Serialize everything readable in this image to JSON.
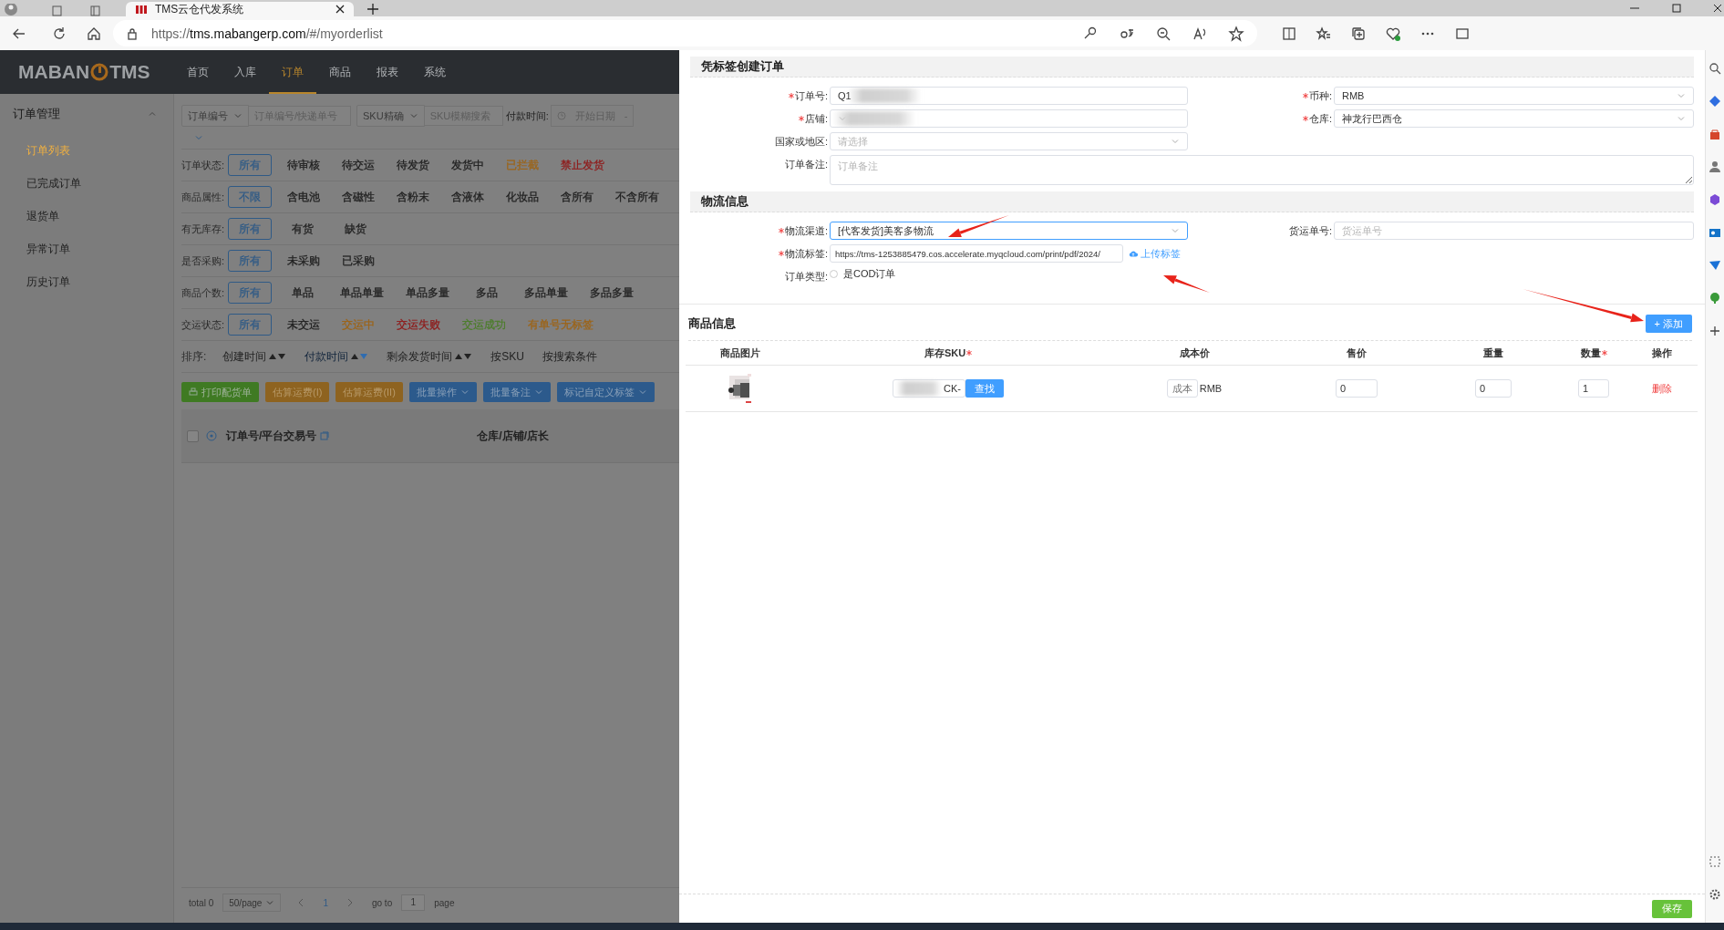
{
  "browser": {
    "tab_title": "TMS云仓代发系统",
    "url_prefix": "https://",
    "url_domain": "tms.mabangerp.com",
    "url_path": "/#/myorderlist"
  },
  "app": {
    "logo": [
      "MABAN",
      "TMS"
    ],
    "nav": [
      {
        "label": "首页",
        "selected": false
      },
      {
        "label": "入库",
        "selected": false
      },
      {
        "label": "订单",
        "selected": true
      },
      {
        "label": "商品",
        "selected": false
      },
      {
        "label": "报表",
        "selected": false
      },
      {
        "label": "系统",
        "selected": false
      }
    ],
    "sidebar": {
      "title": "订单管理",
      "expanded": true,
      "items": [
        {
          "label": "订单列表",
          "selected": true
        },
        {
          "label": "已完成订单",
          "selected": false
        },
        {
          "label": "退货单",
          "selected": false
        },
        {
          "label": "异常订单",
          "selected": false
        },
        {
          "label": "历史订单",
          "selected": false
        }
      ]
    },
    "search": {
      "field_select": "订单编号",
      "field_placeholder": "订单编号/快递单号",
      "sku_select": "SKU精确",
      "sku_placeholder": "SKU模糊搜索",
      "date_label": "付款时间:",
      "date_placeholder": "开始日期",
      "date_separator": "-"
    },
    "filters": [
      {
        "label": "订单状态:",
        "options": [
          {
            "label": "所有",
            "selected": true,
            "color": "#2f5a86"
          },
          {
            "label": "待审核",
            "selected": false,
            "color": "#1f1f1f"
          },
          {
            "label": "待交运",
            "selected": false,
            "color": "#1f1f1f"
          },
          {
            "label": "待发货",
            "selected": false,
            "color": "#1f1f1f"
          },
          {
            "label": "发货中",
            "selected": false,
            "color": "#1f1f1f"
          },
          {
            "label": "已拦截",
            "selected": false,
            "color": "#9c6418"
          },
          {
            "label": "禁止发货",
            "selected": false,
            "color": "#8f1a1a"
          }
        ]
      },
      {
        "label": "商品属性:",
        "options": [
          {
            "label": "不限",
            "selected": true,
            "color": "#2f5a86"
          },
          {
            "label": "含电池",
            "selected": false,
            "color": "#1f1f1f"
          },
          {
            "label": "含磁性",
            "selected": false,
            "color": "#1f1f1f"
          },
          {
            "label": "含粉末",
            "selected": false,
            "color": "#1f1f1f"
          },
          {
            "label": "含液体",
            "selected": false,
            "color": "#1f1f1f"
          },
          {
            "label": "化妆品",
            "selected": false,
            "color": "#1f1f1f"
          },
          {
            "label": "含所有",
            "selected": false,
            "color": "#1f1f1f"
          },
          {
            "label": "不含所有",
            "selected": false,
            "color": "#1f1f1f"
          }
        ]
      },
      {
        "label": "有无库存:",
        "options": [
          {
            "label": "所有",
            "selected": true,
            "color": "#2f5a86"
          },
          {
            "label": "有货",
            "selected": false,
            "color": "#1f1f1f"
          },
          {
            "label": "缺货",
            "selected": false,
            "color": "#1f1f1f"
          }
        ]
      },
      {
        "label": "是否采购:",
        "options": [
          {
            "label": "所有",
            "selected": true,
            "color": "#2f5a86"
          },
          {
            "label": "未采购",
            "selected": false,
            "color": "#1f1f1f"
          },
          {
            "label": "已采购",
            "selected": false,
            "color": "#1f1f1f"
          }
        ]
      },
      {
        "label": "商品个数:",
        "options": [
          {
            "label": "所有",
            "selected": true,
            "color": "#2f5a86"
          },
          {
            "label": "单品",
            "selected": false,
            "color": "#1f1f1f"
          },
          {
            "label": "单品单量",
            "selected": false,
            "color": "#1f1f1f"
          },
          {
            "label": "单品多量",
            "selected": false,
            "color": "#1f1f1f"
          },
          {
            "label": "多品",
            "selected": false,
            "color": "#1f1f1f"
          },
          {
            "label": "多品单量",
            "selected": false,
            "color": "#1f1f1f"
          },
          {
            "label": "多品多量",
            "selected": false,
            "color": "#1f1f1f"
          }
        ]
      },
      {
        "label": "交运状态:",
        "options": [
          {
            "label": "所有",
            "selected": true,
            "color": "#2f5a86"
          },
          {
            "label": "未交运",
            "selected": false,
            "color": "#1f1f1f"
          },
          {
            "label": "交运中",
            "selected": false,
            "color": "#9c6418"
          },
          {
            "label": "交运失败",
            "selected": false,
            "color": "#8f1a1a"
          },
          {
            "label": "交运成功",
            "selected": false,
            "color": "#4c7d2b"
          },
          {
            "label": "有单号无标签",
            "selected": false,
            "color": "#9c6418"
          }
        ]
      }
    ],
    "sort": {
      "label": "排序:",
      "items": [
        {
          "label": "创建时间",
          "kind": "sort",
          "selected": false
        },
        {
          "label": "付款时间",
          "kind": "sort",
          "selected": true
        },
        {
          "label": "剩余发货时间",
          "kind": "sort",
          "selected": false
        },
        {
          "label": "按SKU",
          "kind": "plain"
        },
        {
          "label": "按搜索条件",
          "kind": "plain"
        }
      ]
    },
    "actions": [
      {
        "label": "打印配货单",
        "kind": "print",
        "color": "#3f7a23"
      },
      {
        "label": "估算运费(I)",
        "kind": "plain",
        "color": "#8e6320"
      },
      {
        "label": "估算运费(II)",
        "kind": "plain",
        "color": "#8e6320"
      },
      {
        "label": "批量操作",
        "kind": "dropdown",
        "color": "#2c5a8c"
      },
      {
        "label": "批量备注",
        "kind": "dropdown",
        "color": "#2c5a8c"
      },
      {
        "label": "标记自定义标签",
        "kind": "dropdown",
        "color": "#2c5a8c"
      }
    ],
    "table": {
      "select_all_checked": false,
      "columns": [
        "订单号/平台交易号",
        "仓库/店铺/店长"
      ]
    },
    "pagination": {
      "total": "total 0",
      "page_size": "50/page",
      "current_page": "1",
      "goto_label": "go to",
      "goto_value": "1",
      "page_label": "page"
    }
  },
  "drawer": {
    "title": "凭标签创建订单",
    "order_rows": [
      [
        {
          "label": "订单号:",
          "required": true,
          "kind": "input",
          "value": "Q1",
          "redacted": true
        },
        {
          "label": "币种:",
          "required": true,
          "kind": "select",
          "value": "RMB"
        }
      ],
      [
        {
          "label": "店铺:",
          "required": true,
          "kind": "select",
          "redacted": true
        },
        {
          "label": "仓库:",
          "required": true,
          "kind": "select",
          "value": "神龙行巴西仓"
        }
      ],
      [
        {
          "label": "国家或地区:",
          "required": false,
          "kind": "select",
          "placeholder": "请选择"
        }
      ],
      [
        {
          "label": "订单备注:",
          "required": false,
          "kind": "textarea",
          "placeholder": "订单备注"
        }
      ]
    ],
    "logistics_title": "物流信息",
    "logistics_rows": [
      [
        {
          "label": "物流渠道:",
          "required": true,
          "kind": "select",
          "value": "[代客发货]美客多物流",
          "focused": true
        },
        {
          "label": "货运单号:",
          "required": false,
          "kind": "input",
          "placeholder": "货运单号"
        }
      ],
      [
        {
          "label": "物流标签:",
          "required": true,
          "kind": "upload",
          "value": "https://tms-1253885479.cos.accelerate.myqcloud.com/print/pdf/2024/",
          "link": "上传标签"
        }
      ],
      [
        {
          "label": "订单类型:",
          "required": false,
          "kind": "radio",
          "option": "是COD订单",
          "checked": false
        }
      ]
    ],
    "products": {
      "title": "商品信息",
      "add_button": "+ 添加",
      "columns": [
        {
          "label": "商品图片",
          "required": false
        },
        {
          "label": "库存SKU",
          "required": true
        },
        {
          "label": "成本价",
          "required": false
        },
        {
          "label": "售价",
          "required": false
        },
        {
          "label": "重量",
          "required": false
        },
        {
          "label": "数量",
          "required": true
        },
        {
          "label": "操作",
          "required": false
        }
      ],
      "rows": [
        {
          "sku": "CK-",
          "sku_redacted": true,
          "find_button": "查找",
          "cost_placeholder": "成本",
          "currency": "RMB",
          "price": "0",
          "weight": "0",
          "quantity": "1",
          "delete": "删除"
        }
      ]
    },
    "save_button": "保存"
  }
}
